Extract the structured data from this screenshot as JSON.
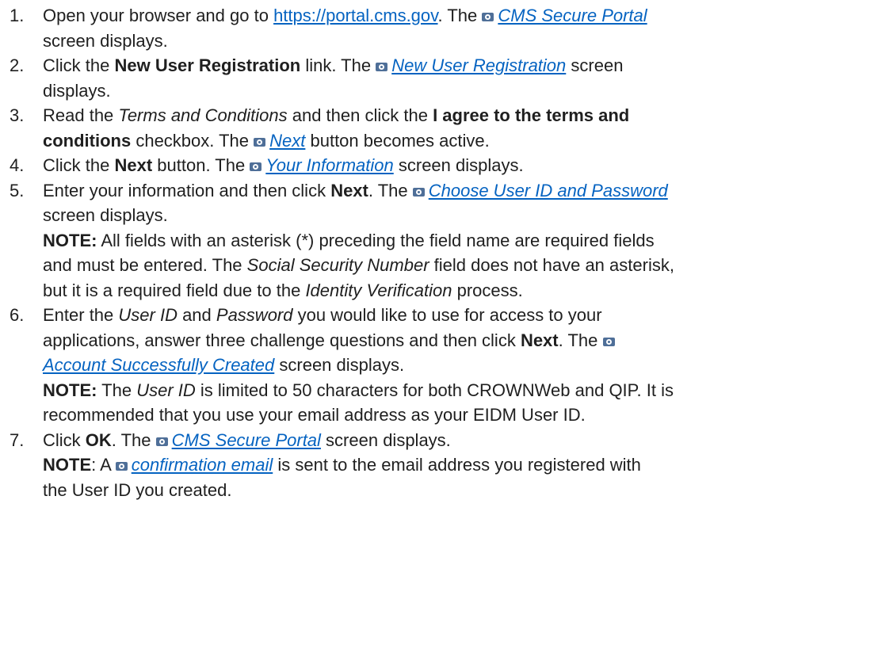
{
  "steps": [
    {
      "number": "1.",
      "lines": [
        [
          "Open your browser and go to ",
          "https://portal.cms.gov",
          ". The ",
          "CMS Secure Portal"
        ],
        [
          "screen displays."
        ]
      ]
    },
    {
      "number": "2.",
      "lines": [
        [
          "Click the ",
          "New User Registration",
          " link. The ",
          "New User Registration",
          " screen"
        ],
        [
          "displays."
        ]
      ]
    },
    {
      "number": "3.",
      "lines": [
        [
          "Read the ",
          "Terms and Conditions",
          " and then click the ",
          "I agree to the terms and"
        ],
        [
          "conditions",
          " checkbox. The ",
          "Next",
          " button becomes active."
        ]
      ]
    },
    {
      "number": "4.",
      "lines": [
        [
          "Click the ",
          "Next",
          " button. The ",
          "Your Information",
          " screen displays."
        ]
      ]
    },
    {
      "number": "5.",
      "lines": [
        [
          "Enter your information and then click ",
          "Next",
          ". The ",
          "Choose User ID and Password"
        ],
        [
          "screen displays."
        ],
        [
          "NOTE:",
          " All fields with an asterisk (*) preceding the field name are required fields"
        ],
        [
          "and must be entered. The ",
          "Social Security Number",
          " field does not have an asterisk,"
        ],
        [
          "but it is a required field due to the ",
          "Identity Verification",
          " process."
        ]
      ]
    },
    {
      "number": "6.",
      "lines": [
        [
          "Enter the ",
          "User ID",
          " and ",
          "Password",
          " you would like to use for access to your"
        ],
        [
          "applications, answer three challenge questions and then click ",
          "Next",
          ". The"
        ],
        [
          "Account Successfully Created",
          " screen displays."
        ],
        [
          "NOTE:",
          " The ",
          "User ID",
          " is limited to 50 characters for both CROWNWeb and QIP. It is"
        ],
        [
          "recommended that you use your email address as your EIDM User ID."
        ]
      ]
    },
    {
      "number": "7.",
      "lines": [
        [
          "Click ",
          "OK",
          ". The ",
          "CMS Secure Portal",
          " screen displays."
        ],
        [
          "NOTE",
          ": A ",
          "confirmation email",
          " is sent to the email address you registered with"
        ],
        [
          "the User ID you created."
        ]
      ]
    }
  ],
  "colors": {
    "link": "#0563c1",
    "text": "#1f1f1f",
    "camera_icon": "#4f6f98"
  },
  "icon": "camera-icon"
}
